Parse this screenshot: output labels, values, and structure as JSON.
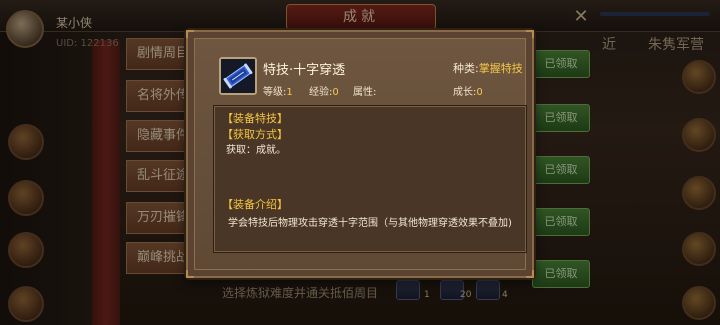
{
  "background": {
    "title": "成就",
    "player": {
      "name": "某小侠",
      "uid": "UID: 122136"
    },
    "top_tabs": [
      "近",
      "朱隽军营"
    ],
    "categories": [
      "剧情周目",
      "名将外传",
      "隐藏事件",
      "乱斗征途",
      "万刃摧锋",
      "巅峰挑战"
    ],
    "claim_label": "已领取",
    "bottom_row": {
      "text": "选择炼狱难度并通关抵佰周目",
      "nums": [
        "1",
        "20",
        "4"
      ]
    }
  },
  "popup": {
    "skill_name": "特技·十字穿透",
    "type_label": "种类:",
    "type_value": "掌握特技",
    "level_label": "等级:",
    "level_value": "1",
    "exp_label": "经验:",
    "exp_value": "0",
    "attr_label": "属性:",
    "attr_value": "",
    "growth_label": "成长:",
    "growth_value": "0",
    "sections": {
      "equip_title": "【装备特技】",
      "source_title": "【获取方式】",
      "source_body": "获取：成就。",
      "intro_title": "【装备介绍】",
      "intro_body": "学会特技后物理攻击穿透十字范围（与其他物理穿透效果不叠加)"
    },
    "icon": "skill-scroll-icon"
  },
  "colors": {
    "highlight": "#f5c84a",
    "section_title": "#f4c640",
    "claim_green": "#3f7a2e"
  }
}
